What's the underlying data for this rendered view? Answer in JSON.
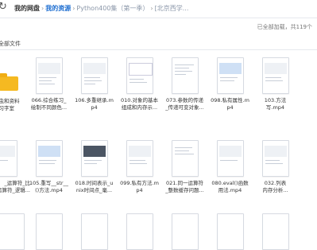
{
  "breadcrumb": {
    "refresh_icon": "refresh-icon",
    "items": [
      "我的网盘",
      "我的资源",
      "Python400集（第一季）",
      "[北京西学..."
    ]
  },
  "status_text": "已全部加载，共119个",
  "all_files_label": "全部文件",
  "files": [
    {
      "name1": "爬虫和资料",
      "name2": "学习字室",
      "icon": "folder-icon"
    },
    {
      "name1": "066.综合练习_",
      "name2": "绘制不同颜色...",
      "icon": "video-thumbnail-icon"
    },
    {
      "name1": "106.多重继承.m",
      "name2": "p4",
      "icon": "video-thumbnail-icon"
    },
    {
      "name1": "010.对象的基本",
      "name2": "组成和内存示...",
      "icon": "video-thumbnail-icon"
    },
    {
      "name1": "073.参数的传递",
      "name2": "_传递可变对象...",
      "icon": "video-thumbnail-icon"
    },
    {
      "name1": "098.私有属性.m",
      "name2": "p4",
      "icon": "video-thumbnail-icon"
    },
    {
      "name1": "103.方法",
      "name2": "写.mp4",
      "icon": "video-thumbnail-icon"
    },
    {
      "name1": "_运算符_比",
      "name2": "运算符_逻辑...",
      "icon": "video-thumbnail-icon"
    },
    {
      "name1": "105.重写__str__",
      "name2": "()方法.mp4",
      "icon": "video-thumbnail-icon"
    },
    {
      "name1": "018.时间表示_u",
      "name2": "nix时间点_毫...",
      "icon": "video-thumbnail-icon"
    },
    {
      "name1": "099.私有方法.m",
      "name2": "p4",
      "icon": "video-thumbnail-icon"
    },
    {
      "name1": "021.同一运算符",
      "name2": "_整数缓存问题...",
      "icon": "video-thumbnail-icon"
    },
    {
      "name1": "080.eval()函数",
      "name2": "用法.mp4",
      "icon": "video-thumbnail-icon"
    },
    {
      "name1": "032.列表",
      "name2": "内存分析...",
      "icon": "video-thumbnail-icon"
    }
  ]
}
